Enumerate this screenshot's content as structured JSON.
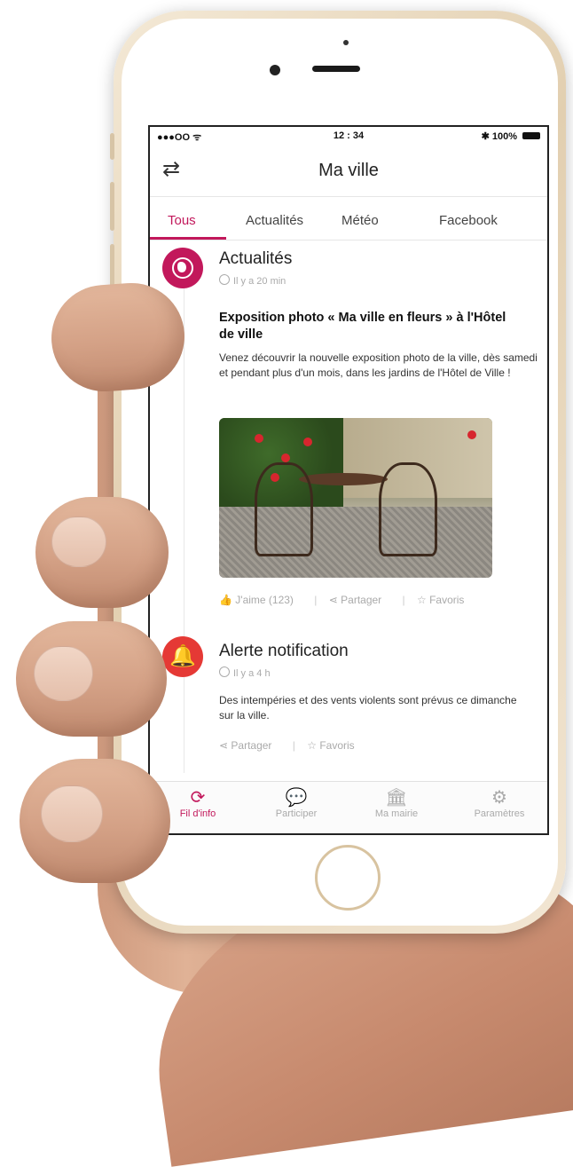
{
  "status": {
    "carrier": "●●●OO ᯤ",
    "time": "12 : 34",
    "battery": "✱ 100%"
  },
  "header": {
    "title": "Ma ville",
    "swap_icon": "swap-arrows-icon"
  },
  "tabs": [
    {
      "label": "Tous",
      "active": true
    },
    {
      "label": "Actualités",
      "active": false
    },
    {
      "label": "Météo",
      "active": false
    },
    {
      "label": "Facebook",
      "active": false
    }
  ],
  "feed": {
    "news": {
      "category": "Actualités",
      "time": "Il y a 20 min",
      "headline": "Exposition photo « Ma ville en fleurs » à l'Hôtel de ville",
      "body": "Venez découvrir la nouvelle exposition photo de la ville, dès samedi et pendant plus d'un mois, dans les jardins de l'Hôtel de Ville !",
      "like": "J'aime (123)",
      "share": "Partager",
      "favorite": "Favoris"
    },
    "alert": {
      "category": "Alerte notification",
      "time": "Il y a 4 h",
      "body": "Des intempéries et des vents violents sont prévus ce dimanche sur la ville.",
      "share": "Partager",
      "favorite": "Favoris"
    }
  },
  "tabbar": [
    {
      "label": "Fil d'info",
      "icon": "refresh-icon",
      "active": true
    },
    {
      "label": "Participer",
      "icon": "chat-icon",
      "active": false
    },
    {
      "label": "Ma mairie",
      "icon": "town-hall-icon",
      "active": false
    },
    {
      "label": "Paramètres",
      "icon": "gear-icon",
      "active": false
    }
  ],
  "colors": {
    "accent": "#c2185b",
    "alert": "#e53935"
  }
}
